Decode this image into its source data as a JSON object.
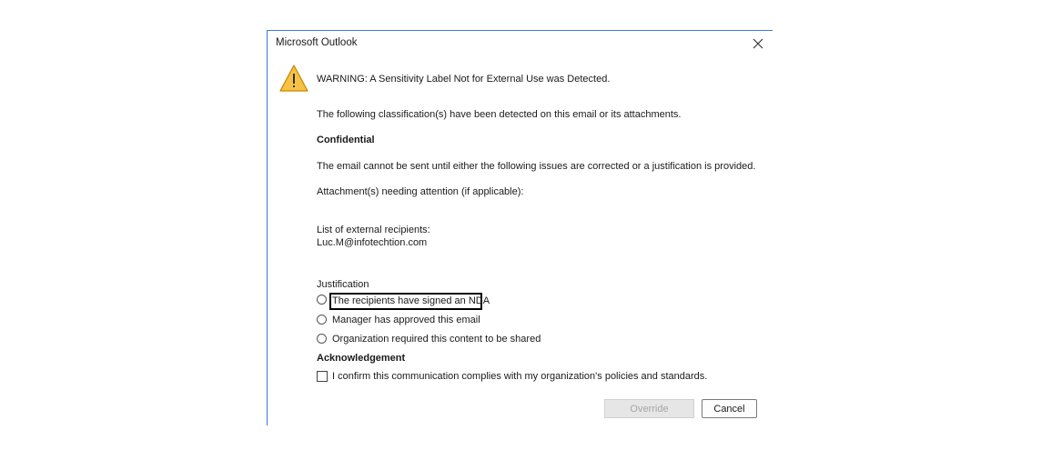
{
  "dialog": {
    "title": "Microsoft Outlook",
    "warning": "WARNING: A Sensitivity Label Not for External Use was Detected.",
    "classifications_intro": "The following classification(s) have been detected on this email or its attachments.",
    "classification": "Confidential",
    "cannot_send": "The email cannot be sent until either the following issues are corrected or a justification is provided.",
    "attachments_label": "Attachment(s) needing attention (if applicable):",
    "recipients_label": "List of external recipients:",
    "recipient": "Luc.M@infotechtion.com",
    "justification_label": "Justification",
    "justification_options": [
      "The recipients have signed an NDA",
      "Manager has approved this email",
      "Organization required this content to be shared"
    ],
    "acknowledgement_label": "Acknowledgement",
    "acknowledgement_text": "I confirm this communication complies with my organization's policies and standards.",
    "override_label": "Override",
    "cancel_label": "Cancel",
    "override_enabled": false,
    "acknowledgement_checked": false,
    "icons": {
      "close": "close-icon",
      "warning": "warning-icon"
    },
    "colors": {
      "warning_fill": "#f6c145",
      "warning_stroke": "#c88a00",
      "accent_border": "#3a7bd5"
    }
  }
}
